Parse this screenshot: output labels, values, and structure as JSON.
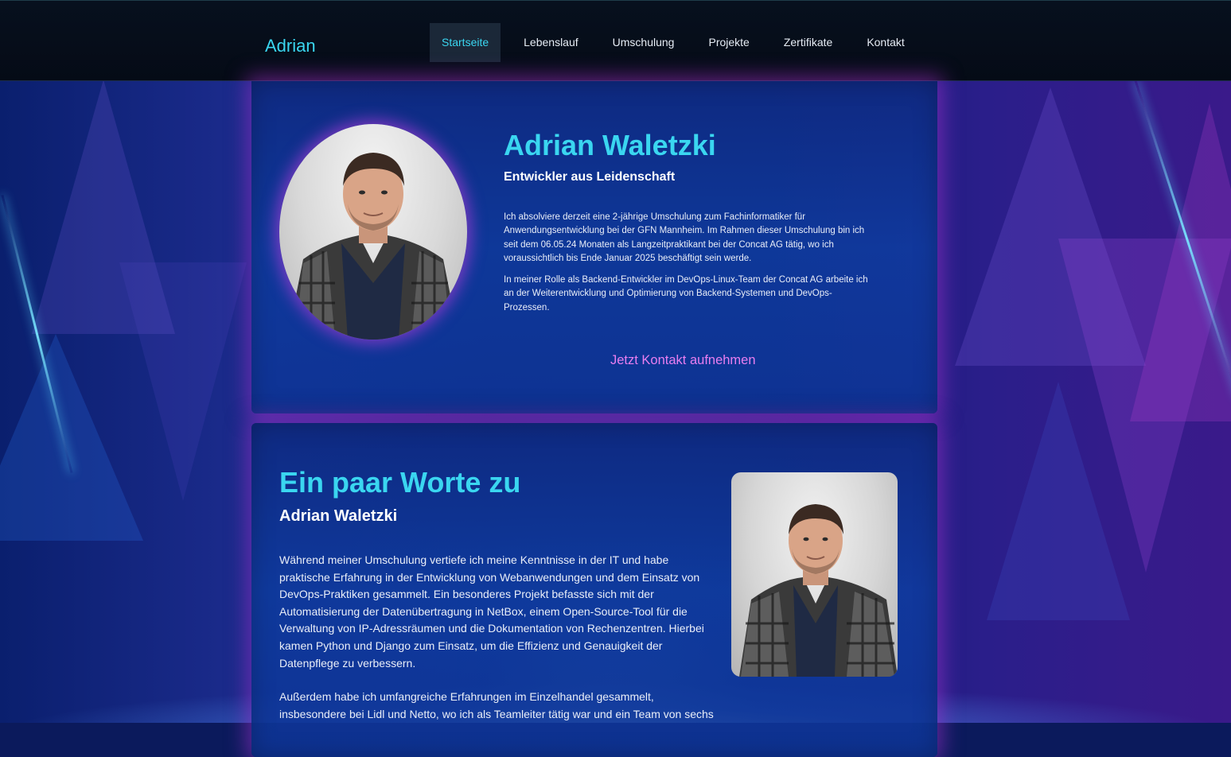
{
  "header": {
    "brand": "Adrian",
    "nav": [
      {
        "label": "Startseite"
      },
      {
        "label": "Lebenslauf"
      },
      {
        "label": "Umschulung"
      },
      {
        "label": "Projekte"
      },
      {
        "label": "Zertifikate"
      },
      {
        "label": "Kontakt"
      }
    ]
  },
  "hero": {
    "name": "Adrian Waletzki",
    "tagline": "Entwickler aus Leidenschaft",
    "paragraphs": [
      "Ich absolviere derzeit eine 2-jährige Umschulung zum Fachinformatiker für Anwendungsentwicklung bei der GFN Mannheim. Im Rahmen dieser Umschulung bin ich seit dem 06.05.24 Monaten als Langzeitpraktikant bei der Concat AG tätig, wo ich voraussichtlich bis Ende Januar 2025 beschäftigt sein werde.",
      "In meiner Rolle als Backend-Entwickler im DevOps-Linux-Team der Concat AG arbeite ich an der Weiterentwicklung und Optimierung von Backend-Systemen und DevOps-Prozessen."
    ],
    "cta": "Jetzt Kontakt aufnehmen"
  },
  "about": {
    "title": "Ein paar Worte zu",
    "subtitle": "Adrian Waletzki",
    "paragraphs": [
      "Während meiner Umschulung vertiefe ich meine Kenntnisse in der IT und habe praktische Erfahrung in der Entwicklung von Webanwendungen und dem Einsatz von DevOps-Praktiken gesammelt. Ein besonderes Projekt befasste sich mit der Automatisierung der Datenübertragung in NetBox, einem Open-Source-Tool für die Verwaltung von IP-Adressräumen und die Dokumentation von Rechenzentren. Hierbei kamen Python und Django zum Einsatz, um die Effizienz und Genauigkeit der Datenpflege zu verbessern.",
      "Außerdem habe ich umfangreiche Erfahrungen im Einzelhandel gesammelt, insbesondere bei Lidl und Netto, wo ich als Teamleiter tätig war und ein Team von sechs"
    ]
  },
  "colors": {
    "accent": "#3ad6f0",
    "cta": "#e87ef0",
    "glow": "#aa32d2",
    "header_bg": "#050b16"
  }
}
